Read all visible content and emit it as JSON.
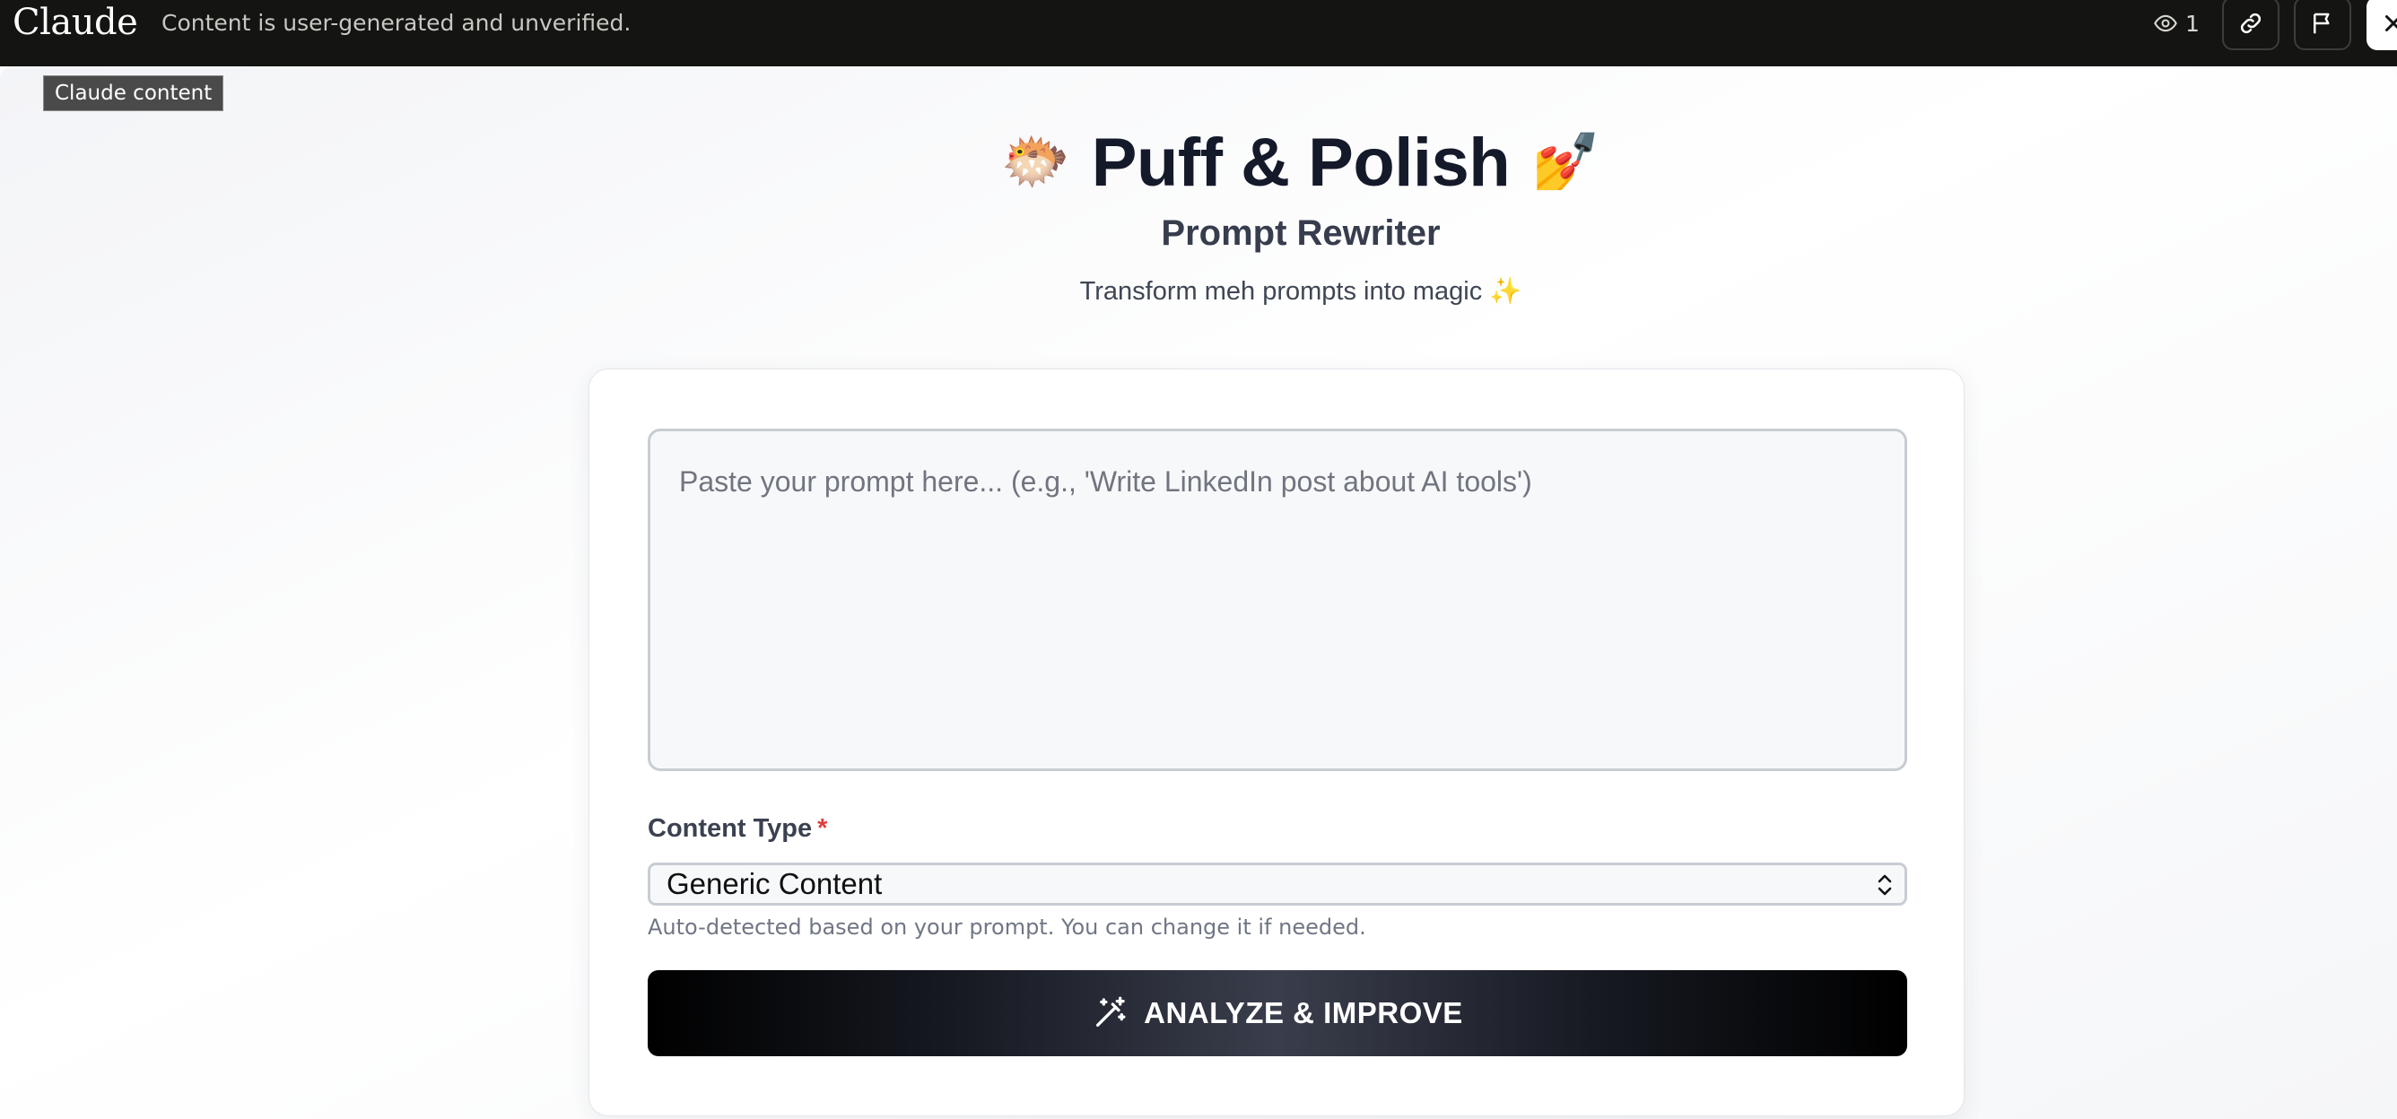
{
  "topbar": {
    "brand": "Claude",
    "notice": "Content is user-generated and unverified.",
    "view_count": "1",
    "icons": [
      "eye-icon",
      "link-icon",
      "flag-icon",
      "close-icon"
    ]
  },
  "tooltip": "Claude content",
  "header": {
    "emoji_left": "🐡",
    "title": "Puff & Polish",
    "emoji_right": "💅",
    "subtitle": "Prompt Rewriter",
    "tagline": "Transform meh prompts into magic ✨"
  },
  "form": {
    "prompt_placeholder": "Paste your prompt here... (e.g., 'Write LinkedIn post about AI tools')",
    "prompt_value": "",
    "content_type_label": "Content Type",
    "required_marker": "*",
    "content_type_selected": "Generic Content",
    "helper_text": "Auto-detected based on your prompt. You can change it if needed.",
    "submit_label": "ANALYZE & IMPROVE",
    "submit_icon": "magic-wand-icon"
  },
  "colors": {
    "topbar_bg": "#141413",
    "title_text": "#151a2b",
    "required": "#e03b3b",
    "button_bg": "#000000"
  }
}
